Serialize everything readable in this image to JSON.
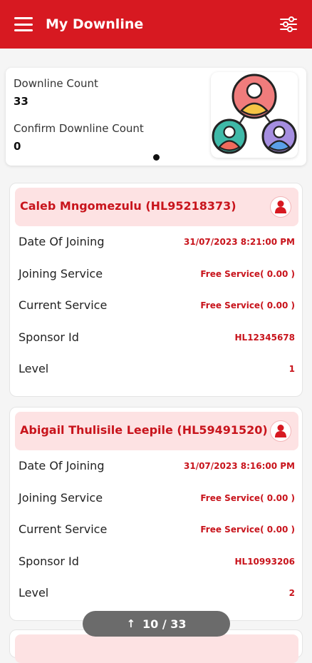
{
  "header": {
    "title": "My Downline"
  },
  "summary": {
    "downline_count_label": "Downline Count",
    "downline_count": "33",
    "confirm_count_label": "Confirm Downline Count",
    "confirm_count": "0"
  },
  "labels": {
    "date_of_joining": "Date Of Joining",
    "joining_service": "Joining Service",
    "current_service": "Current Service",
    "sponsor_id": "Sponsor Id",
    "level": "Level"
  },
  "members": [
    {
      "name": "Caleb Mngomezulu (HL95218373)",
      "date_of_joining": "31/07/2023 8:21:00 PM",
      "joining_service": "Free Service( 0.00 )",
      "current_service": "Free Service( 0.00 )",
      "sponsor_id": "HL12345678",
      "level": "1"
    },
    {
      "name": "Abigail Thulisile Leepile (HL59491520)",
      "date_of_joining": "31/07/2023 8:16:00 PM",
      "joining_service": "Free Service( 0.00 )",
      "current_service": "Free Service( 0.00 )",
      "sponsor_id": "HL10993206",
      "level": "2"
    }
  ],
  "pager": {
    "text": "10 / 33"
  },
  "colors": {
    "primary": "#d71921",
    "accent_text": "#c8141c",
    "card_head_bg": "#fde2e3"
  }
}
